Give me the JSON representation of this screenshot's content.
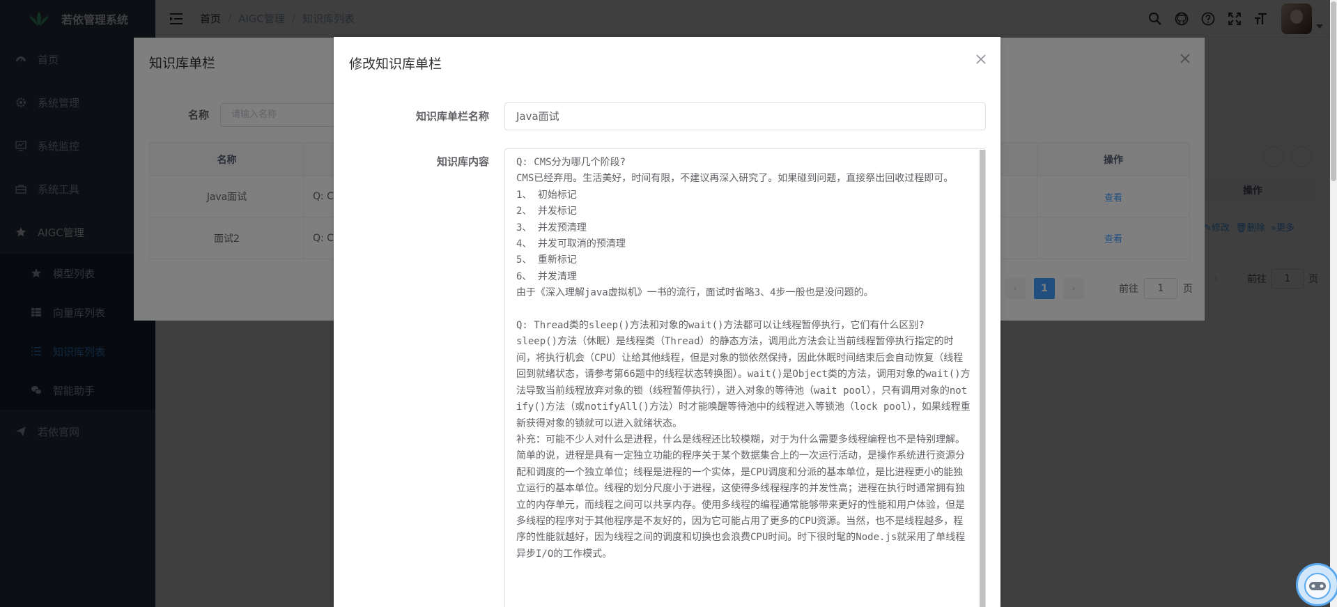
{
  "app": {
    "title": "若依管理系统"
  },
  "sidebar": {
    "items": [
      {
        "label": "首页",
        "icon": "dashboard-icon"
      },
      {
        "label": "系统管理",
        "icon": "gear-icon"
      },
      {
        "label": "系统监控",
        "icon": "monitor-icon"
      },
      {
        "label": "系统工具",
        "icon": "toolbox-icon"
      },
      {
        "label": "AIGC管理",
        "icon": "star-icon"
      }
    ],
    "aigc_sub": [
      {
        "label": "模型列表",
        "icon": "star-icon"
      },
      {
        "label": "向量库列表",
        "icon": "table-icon"
      },
      {
        "label": "知识库列表",
        "icon": "list-icon"
      },
      {
        "label": "智能助手",
        "icon": "chat-icon"
      }
    ],
    "website": {
      "label": "若依官网",
      "icon": "send-icon"
    }
  },
  "breadcrumb": {
    "home": "首页",
    "section": "AIGC管理",
    "current": "知识库列表"
  },
  "background_page": {
    "header_action": "操作",
    "row_actions": {
      "edit": "修改",
      "delete": "删除",
      "more": "更多"
    },
    "pager": {
      "goto": "前往",
      "page_value": "1",
      "page_unit": "页"
    }
  },
  "dialog_list": {
    "title": "知识库单栏",
    "search_label": "名称",
    "search_placeholder": "请输入名称",
    "columns": {
      "name": "名称",
      "action": "操作"
    },
    "rows": [
      {
        "name": "Java面试",
        "content": "Q: C",
        "action": "查看"
      },
      {
        "name": "面试2",
        "content": "Q: C",
        "action": "查看"
      }
    ],
    "pager": {
      "current": "1",
      "goto": "前往",
      "page_value": "1",
      "page_unit": "页"
    }
  },
  "dialog_edit": {
    "title": "修改知识库单栏",
    "name_label": "知识库单栏名称",
    "name_value": "Java面试",
    "content_label": "知识库内容",
    "content_value": "Q: CMS分为哪几个阶段?\nCMS已经弃用。生活美好，时间有限，不建议再深入研究了。如果碰到问题，直接祭出回收过程即可。\n1、 初始标记\n2、 并发标记\n3、 并发预清理\n4、 并发可取消的预清理\n5、 重新标记\n6、 并发清理\n由于《深入理解java虚拟机》一书的流行，面试时省略3、4步一般也是没问题的。\n\nQ: Thread类的sleep()方法和对象的wait()方法都可以让线程暂停执行，它们有什么区别?\nsleep()方法（休眠）是线程类（Thread）的静态方法，调用此方法会让当前线程暂停执行指定的时间，将执行机会（CPU）让给其他线程，但是对象的锁依然保持，因此休眠时间结束后会自动恢复（线程回到就绪状态，请参考第66题中的线程状态转换图）。wait()是Object类的方法，调用对象的wait()方法导致当前线程放弃对象的锁（线程暂停执行），进入对象的等待池（wait pool），只有调用对象的notify()方法（或notifyAll()方法）时才能唤醒等待池中的线程进入等锁池（lock pool），如果线程重新获得对象的锁就可以进入就绪状态。\n补充：可能不少人对什么是进程，什么是线程还比较模糊，对于为什么需要多线程编程也不是特别理解。简单的说，进程是具有一定独立功能的程序关于某个数据集合上的一次运行活动，是操作系统进行资源分配和调度的一个独立单位；线程是进程的一个实体，是CPU调度和分派的基本单位，是比进程更小的能独立运行的基本单位。线程的划分尺度小于进程，这使得多线程程序的并发性高；进程在执行时通常拥有独立的内存单元，而线程之间可以共享内存。使用多线程的编程通常能够带来更好的性能和用户体验，但是多线程的程序对于其他程序是不友好的，因为它可能占用了更多的CPU资源。当然，也不是线程越多，程序的性能就越好，因为线程之间的调度和切换也会浪费CPU时间。时下很时髦的Node.js就采用了单线程异步I/O的工作模式。"
  }
}
